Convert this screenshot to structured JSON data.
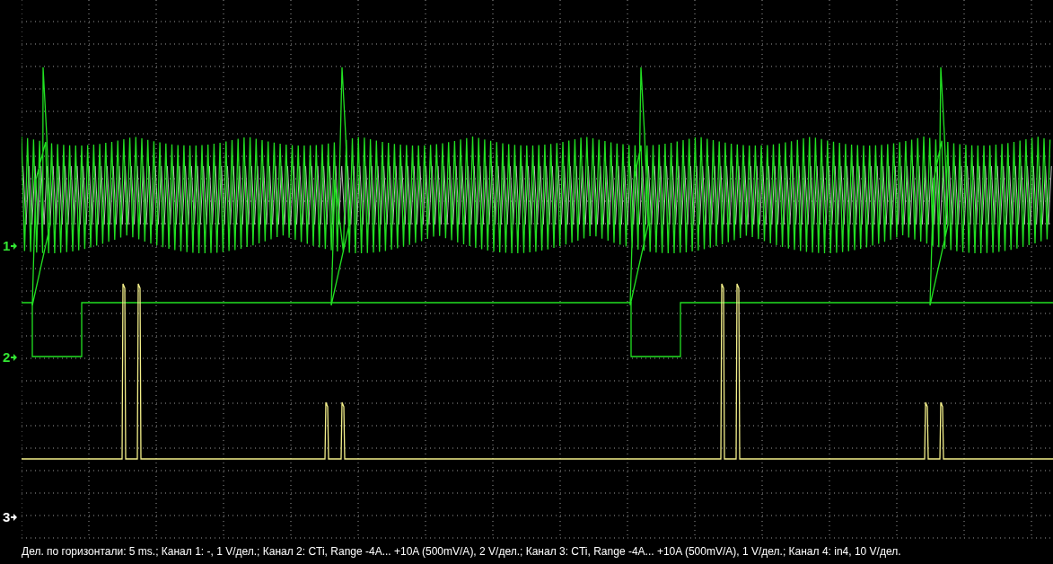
{
  "channel_markers": [
    {
      "label": "1",
      "color": "#33e633"
    },
    {
      "label": "2",
      "color": "#33e633"
    },
    {
      "label": "3",
      "color": "#ffffff"
    }
  ],
  "status_bar": {
    "text": "Дел. по горизонтали: 5 ms.; Канал 1: -, 1 V/дел.; Канал 2: CTi, Range -4A... +10A (500mV/A), 2 V/дел.; Канал 3: CTi, Range -4A... +10A (500mV/A), 1 V/дел.; Канал 4: in4, 10 V/дел."
  }
}
